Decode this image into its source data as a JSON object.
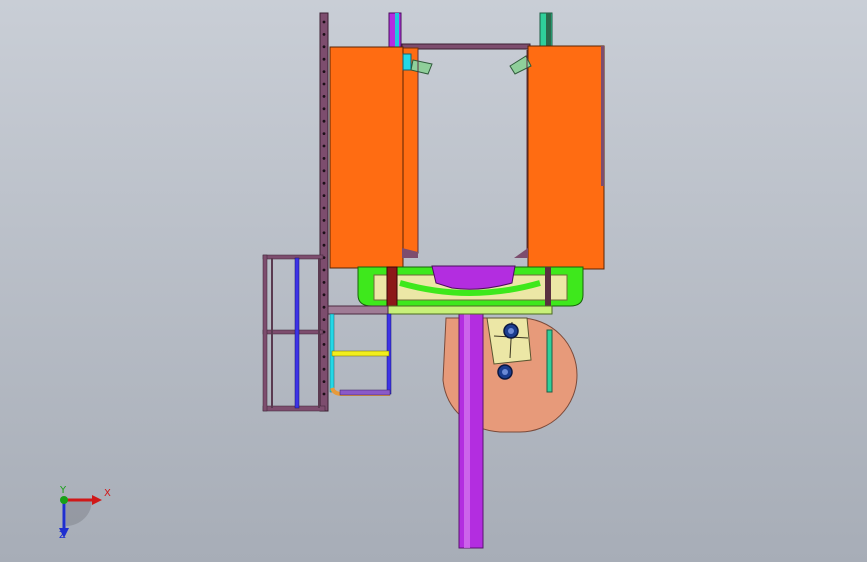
{
  "viewport": {
    "background_top": "#c9ced6",
    "background_bottom": "#a7adb7"
  },
  "model": {
    "colors": {
      "orange_panel": "#ff6c12",
      "frame_purple": "#7d4d6e",
      "pole_magenta": "#b32de0",
      "tank_salmon": "#e79a7a",
      "green_pipe": "#3ee81c",
      "cream_plate": "#ece7a6",
      "yellow_rung": "#f2ee1c",
      "blue_rod": "#3d33e6",
      "cyan": "#24d8e6",
      "dark_red": "#8c1818",
      "wheel_navy": "#1b3d8f"
    }
  },
  "triad": {
    "x_label": "X",
    "y_label": "Y",
    "z_label": "Z",
    "x_color": "#d01818",
    "y_color": "#18a018",
    "z_color": "#1f2fd0"
  }
}
